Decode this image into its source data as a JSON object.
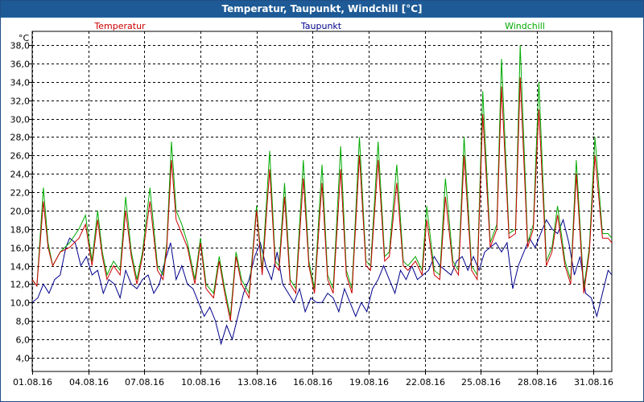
{
  "window": {
    "title": "Temperatur, Taupunkt, Windchill [°C]"
  },
  "colors": {
    "titlebar": "#1d5a96",
    "temperatur": "#cc0000",
    "taupunkt": "#00008b",
    "windchill": "#00aa00",
    "grid": "#000000"
  },
  "chart_data": {
    "type": "line",
    "title": "Temperatur, Taupunkt, Windchill [°C]",
    "ylabel": "°C",
    "xlabel": "",
    "ylim": [
      2.5,
      39.5
    ],
    "xlim": [
      0,
      31
    ],
    "y_ticks": [
      "4,0",
      "6,0",
      "8,0",
      "10,0",
      "12,0",
      "14,0",
      "16,0",
      "18,0",
      "20,0",
      "22,0",
      "24,0",
      "26,0",
      "28,0",
      "30,0",
      "32,0",
      "34,0",
      "36,0",
      "38,0"
    ],
    "x_ticks": [
      "01.08.16",
      "04.08.16",
      "07.08.16",
      "10.08.16",
      "13.08.16",
      "16.08.16",
      "19.08.16",
      "22.08.16",
      "25.08.16",
      "28.08.16",
      "31.08.16"
    ],
    "grid": true,
    "legend_position": "top",
    "series": [
      {
        "name": "Temperatur",
        "x": [
          0,
          0.25,
          0.6,
          0.85,
          1.1,
          1.5,
          2.0,
          2.5,
          2.85,
          3.2,
          3.5,
          3.75,
          4.0,
          4.35,
          4.7,
          5.0,
          5.3,
          5.6,
          5.9,
          6.3,
          6.7,
          7.0,
          7.2,
          7.45,
          7.7,
          8.0,
          8.3,
          8.7,
          9.0,
          9.3,
          9.7,
          10.0,
          10.3,
          10.6,
          10.9,
          11.2,
          11.6,
          12.0,
          12.3,
          12.7,
          13.0,
          13.2,
          13.5,
          13.8,
          14.1,
          14.5,
          14.8,
          15.1,
          15.5,
          15.8,
          16.1,
          16.5,
          16.8,
          17.1,
          17.5,
          17.85,
          18.1,
          18.5,
          18.85,
          19.1,
          19.5,
          19.85,
          20.1,
          20.5,
          20.85,
          21.1,
          21.5,
          21.8,
          22.1,
          22.5,
          22.8,
          23.1,
          23.5,
          23.8,
          24.1,
          24.5,
          24.85,
          25.1,
          25.5,
          25.85,
          26.1,
          26.5,
          26.8,
          27.1,
          27.5,
          27.8,
          28.1,
          28.5,
          28.8,
          29.1,
          29.5,
          29.8,
          30.1,
          30.5,
          30.8,
          31.0
        ],
        "values": [
          12.5,
          11.8,
          21.0,
          16.0,
          14.0,
          15.5,
          16.0,
          17.0,
          18.5,
          14.0,
          19.0,
          15.0,
          12.5,
          14.0,
          13.0,
          20.0,
          15.0,
          12.0,
          15.0,
          21.0,
          13.5,
          12.5,
          16.0,
          25.5,
          19.0,
          17.5,
          16.0,
          12.0,
          16.5,
          11.5,
          10.5,
          14.5,
          11.0,
          8.0,
          15.0,
          12.0,
          10.5,
          20.0,
          13.0,
          24.5,
          14.0,
          13.5,
          21.5,
          12.0,
          11.0,
          23.5,
          14.0,
          11.0,
          23.0,
          12.5,
          11.0,
          24.5,
          13.0,
          11.0,
          26.0,
          14.0,
          13.5,
          25.5,
          14.5,
          15.0,
          23.0,
          14.0,
          13.5,
          14.5,
          13.0,
          19.0,
          13.0,
          12.5,
          21.5,
          14.0,
          13.0,
          26.0,
          13.5,
          12.5,
          30.5,
          16.0,
          18.0,
          33.5,
          17.0,
          17.5,
          34.5,
          16.0,
          18.0,
          31.0,
          14.0,
          15.5,
          19.5,
          14.0,
          12.0,
          24.0,
          11.0,
          15.5,
          26.0,
          17.0,
          17.0,
          16.5
        ]
      },
      {
        "name": "Taupunkt",
        "x": [
          0,
          0.3,
          0.6,
          0.9,
          1.2,
          1.5,
          1.8,
          2.0,
          2.3,
          2.6,
          2.9,
          3.2,
          3.5,
          3.8,
          4.1,
          4.4,
          4.7,
          5.0,
          5.3,
          5.6,
          5.9,
          6.2,
          6.5,
          6.8,
          7.1,
          7.4,
          7.7,
          8.0,
          8.3,
          8.6,
          8.9,
          9.2,
          9.5,
          9.8,
          10.1,
          10.4,
          10.7,
          11.0,
          11.3,
          11.6,
          11.9,
          12.2,
          12.5,
          12.8,
          13.1,
          13.4,
          13.7,
          14.0,
          14.3,
          14.6,
          14.9,
          15.2,
          15.5,
          15.8,
          16.1,
          16.4,
          16.7,
          17.0,
          17.3,
          17.6,
          17.9,
          18.2,
          18.5,
          18.8,
          19.1,
          19.4,
          19.7,
          20.0,
          20.3,
          20.6,
          20.9,
          21.2,
          21.5,
          21.8,
          22.1,
          22.4,
          22.7,
          23.0,
          23.3,
          23.6,
          23.9,
          24.2,
          24.5,
          24.8,
          25.1,
          25.4,
          25.7,
          26.0,
          26.3,
          26.6,
          26.9,
          27.2,
          27.5,
          27.8,
          28.1,
          28.4,
          28.7,
          29.0,
          29.3,
          29.6,
          29.9,
          30.2,
          30.5,
          30.8,
          31.0
        ],
        "values": [
          10.0,
          10.5,
          12.0,
          11.0,
          12.5,
          13.0,
          16.0,
          17.0,
          16.5,
          14.0,
          15.0,
          13.0,
          13.5,
          11.0,
          12.5,
          12.0,
          10.5,
          13.5,
          12.0,
          11.5,
          12.5,
          13.0,
          11.0,
          12.0,
          14.5,
          16.5,
          12.5,
          14.0,
          12.0,
          11.5,
          10.0,
          8.5,
          9.5,
          8.0,
          5.5,
          7.5,
          6.0,
          8.5,
          11.0,
          12.5,
          15.0,
          16.5,
          14.0,
          12.5,
          15.5,
          12.0,
          11.0,
          10.0,
          11.5,
          9.0,
          10.5,
          10.0,
          10.0,
          11.0,
          10.5,
          9.0,
          11.5,
          10.0,
          8.5,
          10.0,
          9.0,
          11.5,
          12.5,
          14.0,
          12.5,
          11.0,
          13.5,
          12.5,
          14.0,
          12.5,
          13.0,
          13.5,
          15.0,
          14.0,
          13.5,
          13.0,
          14.5,
          15.0,
          13.5,
          15.0,
          13.5,
          15.5,
          16.0,
          16.5,
          15.5,
          16.5,
          11.5,
          14.0,
          15.5,
          17.0,
          16.0,
          17.5,
          19.0,
          18.0,
          17.5,
          19.0,
          16.5,
          13.0,
          15.0,
          11.0,
          10.5,
          8.5,
          11.0,
          13.5,
          13.0
        ]
      },
      {
        "name": "Windchill",
        "x": [
          0,
          0.25,
          0.6,
          0.85,
          1.1,
          1.5,
          2.0,
          2.5,
          2.85,
          3.2,
          3.5,
          3.75,
          4.0,
          4.35,
          4.7,
          5.0,
          5.3,
          5.6,
          5.9,
          6.3,
          6.7,
          7.0,
          7.2,
          7.45,
          7.7,
          8.0,
          8.3,
          8.7,
          9.0,
          9.3,
          9.7,
          10.0,
          10.3,
          10.6,
          10.9,
          11.2,
          11.6,
          12.0,
          12.3,
          12.7,
          13.0,
          13.2,
          13.5,
          13.8,
          14.1,
          14.5,
          14.8,
          15.1,
          15.5,
          15.8,
          16.1,
          16.5,
          16.8,
          17.1,
          17.5,
          17.85,
          18.1,
          18.5,
          18.85,
          19.1,
          19.5,
          19.85,
          20.1,
          20.5,
          20.85,
          21.1,
          21.5,
          21.8,
          22.1,
          22.5,
          22.8,
          23.1,
          23.5,
          23.8,
          24.1,
          24.5,
          24.85,
          25.1,
          25.5,
          25.85,
          26.1,
          26.5,
          26.8,
          27.1,
          27.5,
          27.8,
          28.1,
          28.5,
          28.8,
          29.1,
          29.5,
          29.8,
          30.1,
          30.5,
          30.8,
          31.0
        ],
        "values": [
          12.5,
          11.8,
          22.5,
          16.5,
          14.0,
          15.5,
          16.5,
          18.0,
          19.5,
          14.5,
          20.0,
          15.5,
          13.0,
          14.5,
          13.5,
          21.5,
          15.5,
          12.5,
          15.5,
          22.5,
          14.0,
          13.0,
          16.5,
          27.5,
          20.0,
          18.5,
          16.5,
          12.5,
          17.0,
          12.0,
          11.0,
          15.0,
          11.5,
          8.5,
          15.5,
          12.5,
          11.0,
          20.5,
          13.5,
          26.5,
          14.5,
          14.0,
          23.0,
          12.5,
          11.5,
          25.5,
          14.5,
          11.5,
          25.0,
          13.0,
          11.5,
          27.0,
          13.5,
          11.5,
          28.0,
          14.5,
          14.0,
          27.5,
          15.0,
          15.5,
          25.0,
          14.5,
          14.0,
          15.0,
          13.5,
          20.5,
          13.5,
          13.0,
          23.5,
          14.5,
          13.5,
          28.0,
          14.0,
          13.0,
          33.0,
          16.5,
          18.5,
          36.5,
          17.5,
          18.0,
          38.0,
          16.5,
          18.5,
          34.0,
          14.5,
          16.0,
          20.5,
          14.5,
          12.5,
          25.5,
          11.5,
          16.0,
          28.0,
          17.5,
          17.5,
          17.0
        ]
      }
    ]
  }
}
